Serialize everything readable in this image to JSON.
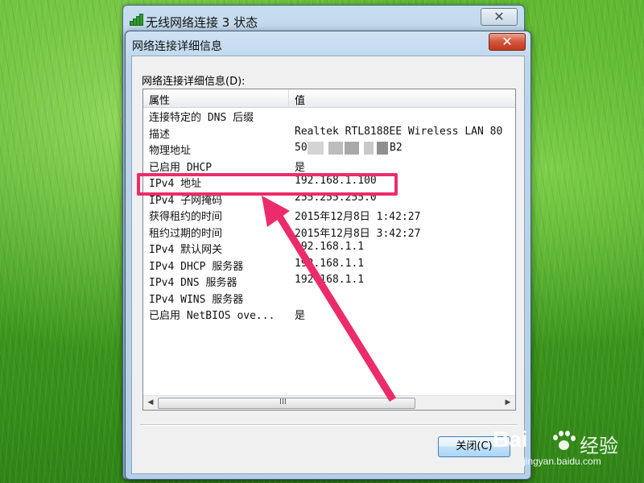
{
  "back_window": {
    "title": "无线网络连接 3 状态",
    "icon": "wireless-signal-icon",
    "close_glyph": "✕"
  },
  "dialog": {
    "title": "网络连接详细信息",
    "close_glyph": "✕",
    "list_label": "网络连接详细信息(D):",
    "columns": [
      "属性",
      "值"
    ],
    "rows": [
      {
        "property": "连接特定的 DNS 后缀",
        "value": ""
      },
      {
        "property": "描述",
        "value": "Realtek RTL8188EE Wireless LAN 80"
      },
      {
        "property": "物理地址",
        "value": "50",
        "value_tail": "B2"
      },
      {
        "property": "已启用 DHCP",
        "value": "是"
      },
      {
        "property": "IPv4 地址",
        "value": "192.168.1.100"
      },
      {
        "property": "IPv4 子网掩码",
        "value": "255.255.255.0"
      },
      {
        "property": "获得租约的时间",
        "value": "2015年12月8日 1:42:27"
      },
      {
        "property": "租约过期的时间",
        "value": "2015年12月8日 3:42:27"
      },
      {
        "property": "IPv4 默认网关",
        "value": "192.168.1.1"
      },
      {
        "property": "IPv4 DHCP 服务器",
        "value": "192.168.1.1"
      },
      {
        "property": "IPv4 DNS 服务器",
        "value": "192.168.1.1"
      },
      {
        "property": "IPv4 WINS 服务器",
        "value": ""
      },
      {
        "property": "已启用 NetBIOS ove...",
        "value": "是"
      }
    ],
    "scroll": {
      "left_arrow": "◀",
      "right_arrow": "▶",
      "grip": "III"
    },
    "close_button": "关闭(C)"
  },
  "annotation": {
    "color": "#ec2c6a",
    "highlighted_row": "IPv4 地址"
  },
  "watermark": {
    "brand": "Bai",
    "brand_suffix": "经验",
    "url": "jingyan.baidu.com"
  }
}
